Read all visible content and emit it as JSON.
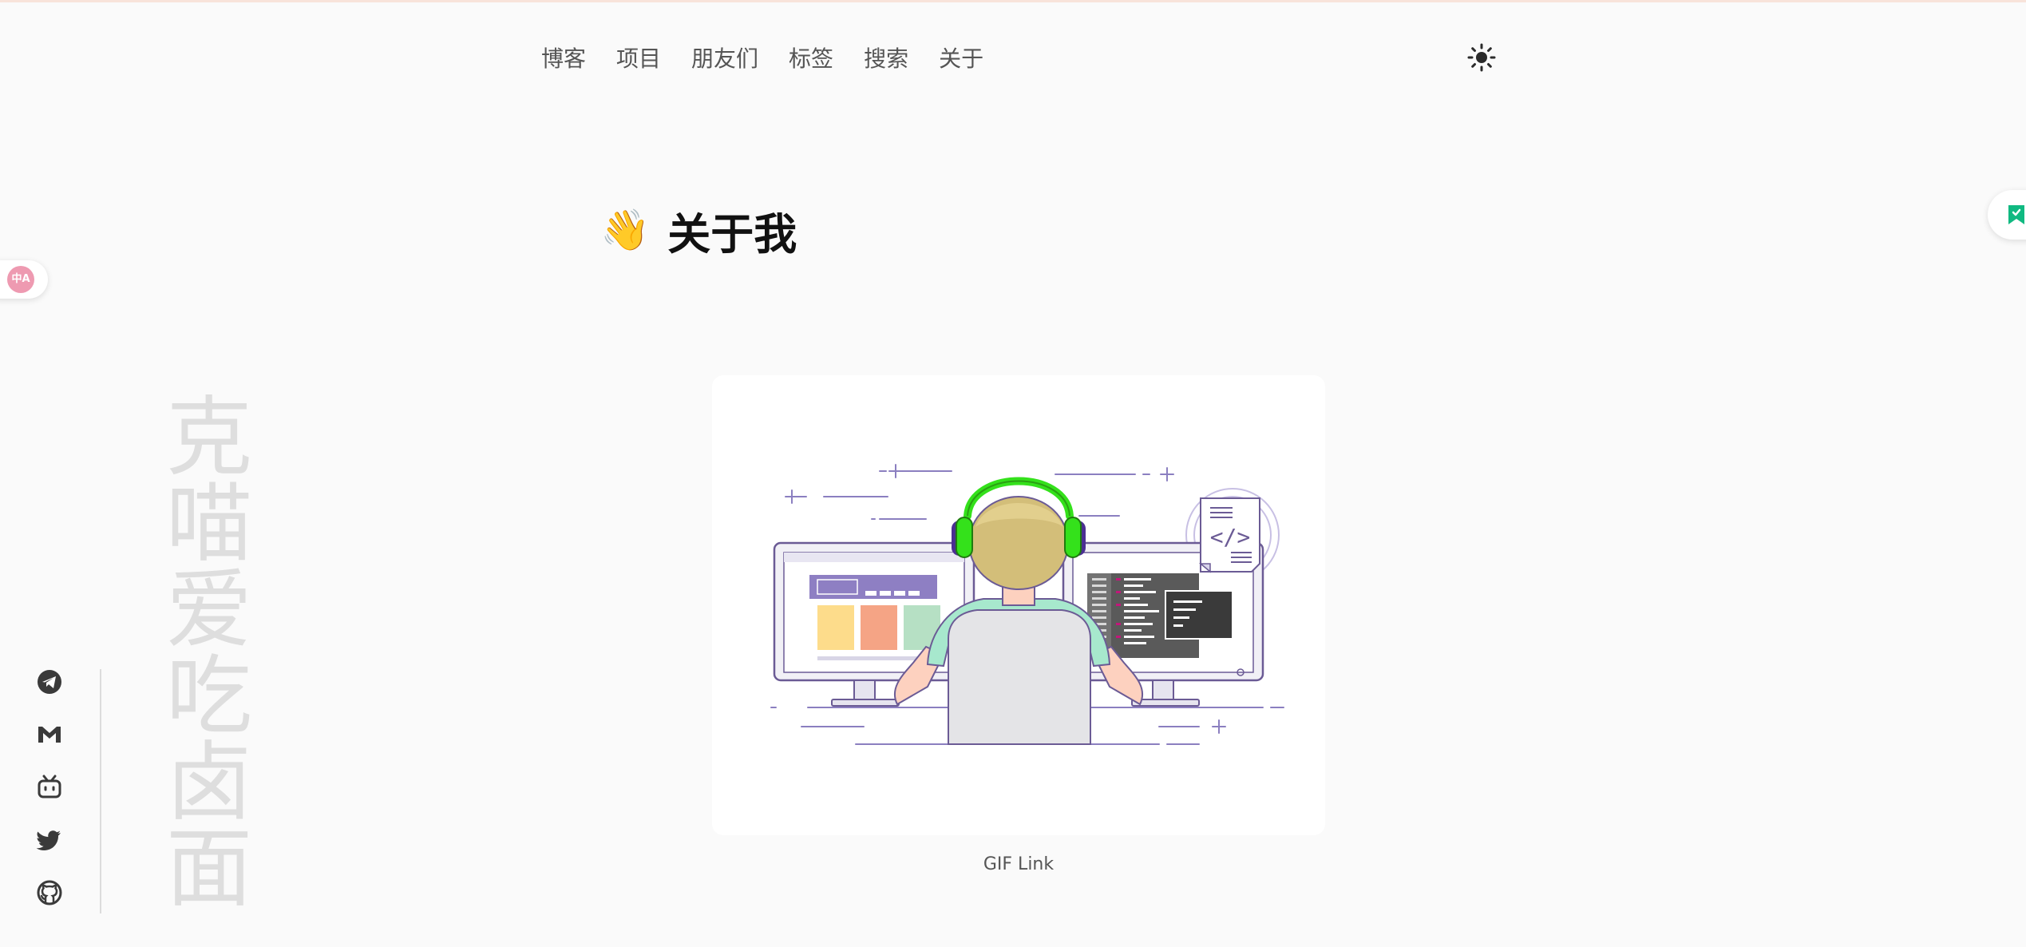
{
  "nav": {
    "items": [
      {
        "label": "博客"
      },
      {
        "label": "项目"
      },
      {
        "label": "朋友们"
      },
      {
        "label": "标签"
      },
      {
        "label": "搜索"
      },
      {
        "label": "关于"
      }
    ],
    "theme_toggle_icon": "sun-icon"
  },
  "page": {
    "title_emoji": "👋",
    "title": "关于我"
  },
  "figure": {
    "caption": "GIF Link",
    "code_tag": "</>"
  },
  "sidebar": {
    "vertical_name": "克喵爱吃卤面",
    "social_icons": [
      "telegram-icon",
      "gmail-icon",
      "bilibili-icon",
      "twitter-icon",
      "github-icon"
    ]
  },
  "widgets": {
    "translate_label": "中A",
    "bookmark_icon": "bookmark-icon"
  },
  "colors": {
    "background": "#fafafa",
    "accent_top_line": "#f8e3da",
    "translate_badge": "#ee9ab1",
    "bookmark": "#10b981",
    "headphones": "#34e11b",
    "illustration_purple": "#6b5b95"
  }
}
